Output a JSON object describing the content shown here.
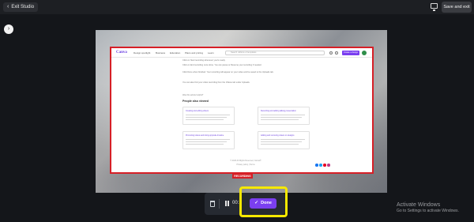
{
  "header": {
    "exit_label": "Exit Studio",
    "save_exit_label": "Save and exit"
  },
  "recorded_page": {
    "logo": "Canva",
    "menu": [
      "Design spotlight",
      "Business",
      "Education",
      "Plans and pricing",
      "Learn"
    ],
    "search_placeholder": "Search millions of templates",
    "cta": "Create a design",
    "steps": [
      "Click on Start recording whenever you're ready.",
      "Click on End recording once done. You can pause or Resume your recording if needed.",
      "Click Done when finished. Your recording will appear on your video and be saved to the Uploads tab.",
      "You can also find your video recording from the Videos tab under Uploads."
    ],
    "feedback": "Was this article helpful?",
    "section_title": "People also viewed",
    "cards": [
      "Creating and editing videos",
      "Recording and adding talking presentation",
      "Promoting videos and doing opposite timeline",
      "Adding and removing videos on designs"
    ],
    "footer": [
      "© 2023 All Rights Reserved, Canva®",
      "Privacy policy | Terms"
    ],
    "social_colors": [
      "#1877f2",
      "#1da1f2",
      "#e60023",
      "#c13584"
    ]
  },
  "recording_badge": "RECORDING",
  "controls": {
    "timer": "00:1",
    "done_label": "Done"
  },
  "watermark": {
    "title": "Activate Windows",
    "subtitle": "Go to Settings to activate Windows."
  },
  "colors": {
    "accent": "#7b3ff0",
    "recording": "#d61f26",
    "highlight": "#f5e800"
  }
}
